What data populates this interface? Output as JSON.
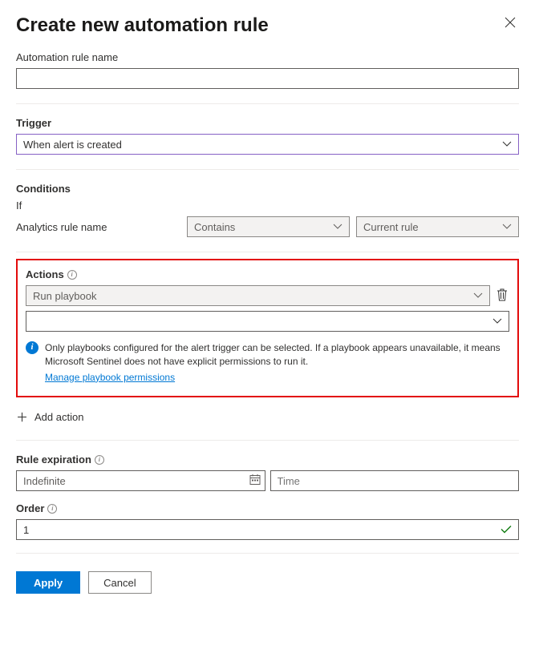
{
  "header": {
    "title": "Create new automation rule"
  },
  "rule_name": {
    "label": "Automation rule name",
    "value": ""
  },
  "trigger": {
    "label": "Trigger",
    "selected": "When alert is created"
  },
  "conditions": {
    "label": "Conditions",
    "if_label": "If",
    "field_label": "Analytics rule name",
    "operator": "Contains",
    "value": "Current rule"
  },
  "actions": {
    "label": "Actions",
    "type_selected": "Run playbook",
    "playbook_selected": "",
    "info_text": "Only playbooks configured for the alert trigger can be selected. If a playbook appears unavailable, it means Microsoft Sentinel does not have explicit permissions to run it.",
    "permissions_link": "Manage playbook permissions",
    "add_label": "Add action"
  },
  "expiration": {
    "label": "Rule expiration",
    "date_value": "Indefinite",
    "time_placeholder": "Time"
  },
  "order": {
    "label": "Order",
    "value": "1"
  },
  "footer": {
    "apply": "Apply",
    "cancel": "Cancel"
  }
}
